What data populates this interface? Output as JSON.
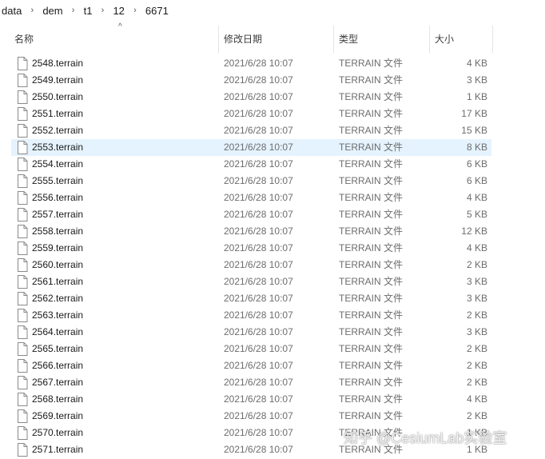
{
  "breadcrumb": {
    "items": [
      "data",
      "dem",
      "t1",
      "12",
      "6671"
    ]
  },
  "columns": {
    "name": "名称",
    "date": "修改日期",
    "type": "类型",
    "size": "大小"
  },
  "sort": {
    "column": "name",
    "direction": "ascending",
    "indicator": "^"
  },
  "icons": {
    "chevron": "chevron-right-icon",
    "file": "file-icon"
  },
  "colors": {
    "selected_row": "#e5f3ff",
    "meta_text": "#6d6d6d"
  },
  "files": [
    {
      "name": "2548.terrain",
      "date": "2021/6/28 10:07",
      "type": "TERRAIN 文件",
      "size": "4 KB"
    },
    {
      "name": "2549.terrain",
      "date": "2021/6/28 10:07",
      "type": "TERRAIN 文件",
      "size": "3 KB"
    },
    {
      "name": "2550.terrain",
      "date": "2021/6/28 10:07",
      "type": "TERRAIN 文件",
      "size": "1 KB"
    },
    {
      "name": "2551.terrain",
      "date": "2021/6/28 10:07",
      "type": "TERRAIN 文件",
      "size": "17 KB"
    },
    {
      "name": "2552.terrain",
      "date": "2021/6/28 10:07",
      "type": "TERRAIN 文件",
      "size": "15 KB"
    },
    {
      "name": "2553.terrain",
      "date": "2021/6/28 10:07",
      "type": "TERRAIN 文件",
      "size": "8 KB",
      "selected": true
    },
    {
      "name": "2554.terrain",
      "date": "2021/6/28 10:07",
      "type": "TERRAIN 文件",
      "size": "6 KB"
    },
    {
      "name": "2555.terrain",
      "date": "2021/6/28 10:07",
      "type": "TERRAIN 文件",
      "size": "6 KB"
    },
    {
      "name": "2556.terrain",
      "date": "2021/6/28 10:07",
      "type": "TERRAIN 文件",
      "size": "4 KB"
    },
    {
      "name": "2557.terrain",
      "date": "2021/6/28 10:07",
      "type": "TERRAIN 文件",
      "size": "5 KB"
    },
    {
      "name": "2558.terrain",
      "date": "2021/6/28 10:07",
      "type": "TERRAIN 文件",
      "size": "12 KB"
    },
    {
      "name": "2559.terrain",
      "date": "2021/6/28 10:07",
      "type": "TERRAIN 文件",
      "size": "4 KB"
    },
    {
      "name": "2560.terrain",
      "date": "2021/6/28 10:07",
      "type": "TERRAIN 文件",
      "size": "2 KB"
    },
    {
      "name": "2561.terrain",
      "date": "2021/6/28 10:07",
      "type": "TERRAIN 文件",
      "size": "3 KB"
    },
    {
      "name": "2562.terrain",
      "date": "2021/6/28 10:07",
      "type": "TERRAIN 文件",
      "size": "3 KB"
    },
    {
      "name": "2563.terrain",
      "date": "2021/6/28 10:07",
      "type": "TERRAIN 文件",
      "size": "2 KB"
    },
    {
      "name": "2564.terrain",
      "date": "2021/6/28 10:07",
      "type": "TERRAIN 文件",
      "size": "3 KB"
    },
    {
      "name": "2565.terrain",
      "date": "2021/6/28 10:07",
      "type": "TERRAIN 文件",
      "size": "2 KB"
    },
    {
      "name": "2566.terrain",
      "date": "2021/6/28 10:07",
      "type": "TERRAIN 文件",
      "size": "2 KB"
    },
    {
      "name": "2567.terrain",
      "date": "2021/6/28 10:07",
      "type": "TERRAIN 文件",
      "size": "2 KB"
    },
    {
      "name": "2568.terrain",
      "date": "2021/6/28 10:07",
      "type": "TERRAIN 文件",
      "size": "4 KB"
    },
    {
      "name": "2569.terrain",
      "date": "2021/6/28 10:07",
      "type": "TERRAIN 文件",
      "size": "2 KB"
    },
    {
      "name": "2570.terrain",
      "date": "2021/6/28 10:07",
      "type": "TERRAIN 文件",
      "size": "1 KB"
    },
    {
      "name": "2571.terrain",
      "date": "2021/6/28 10:07",
      "type": "TERRAIN 文件",
      "size": "1 KB"
    }
  ],
  "watermark": "知乎 @CesiumLab实验室"
}
